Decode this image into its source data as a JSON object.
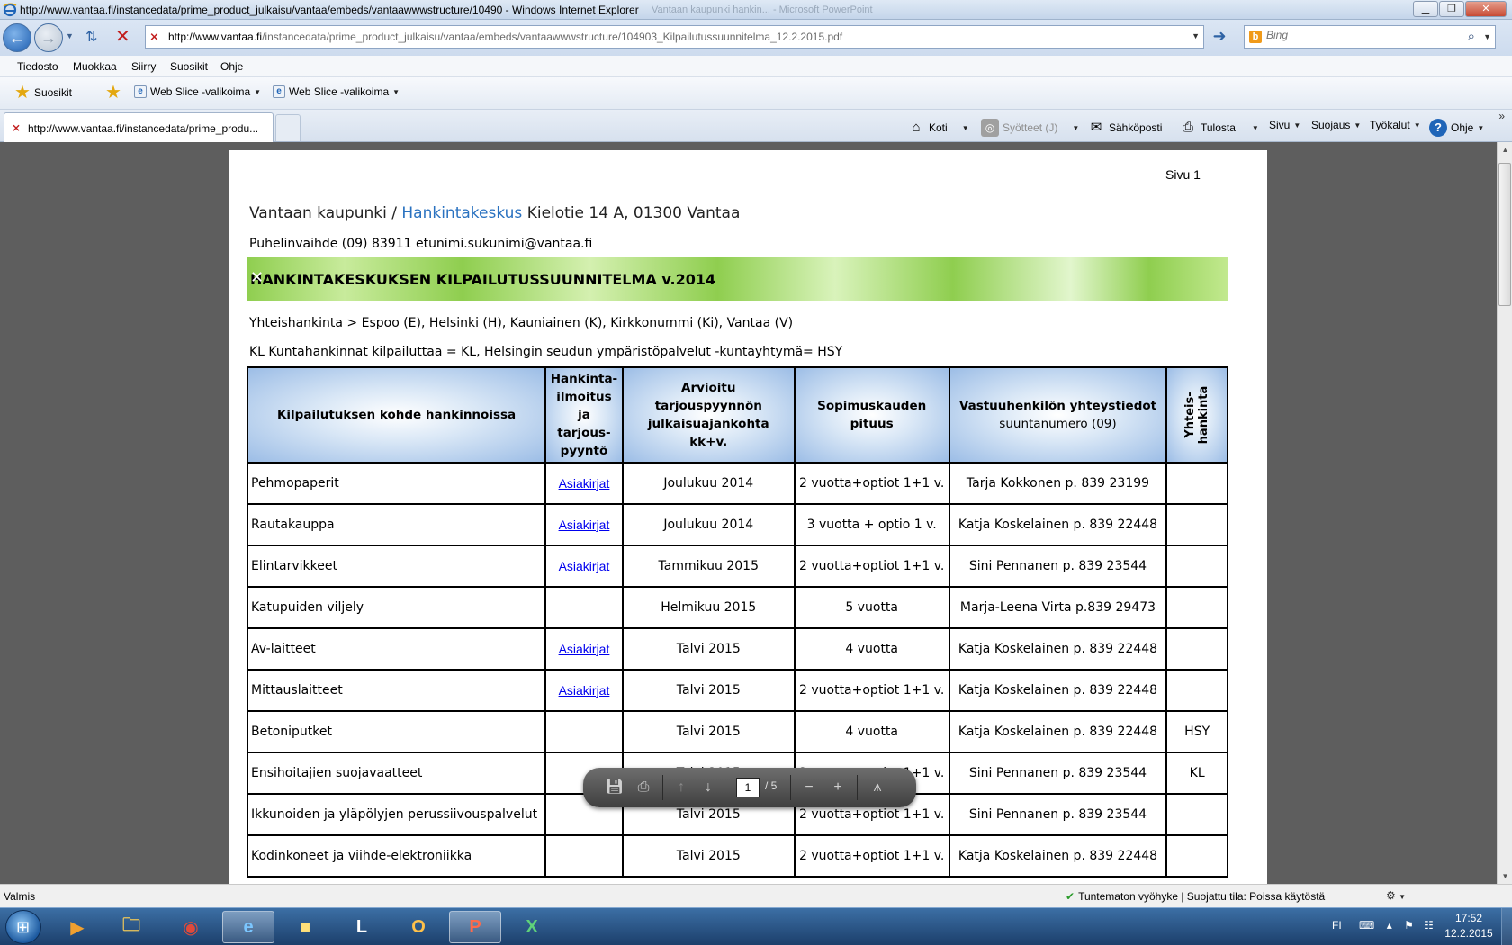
{
  "window": {
    "title": "http://www.vantaa.fi/instancedata/prime_product_julkaisu/vantaa/embeds/vantaawwwstructure/10490 - Windows Internet Explorer",
    "ghost_title": "Vantaan kaupunki hankin... - Microsoft PowerPoint"
  },
  "address_bar": {
    "url_domain": "http://www.vantaa.fi",
    "url_path": "/instancedata/prime_product_julkaisu/vantaa/embeds/vantaawwwstructure/104903_Kilpailutussuunnitelma_12.2.2015.pdf"
  },
  "search": {
    "placeholder": "Bing"
  },
  "menu": [
    "Tiedosto",
    "Muokkaa",
    "Siirry",
    "Suosikit",
    "Ohje"
  ],
  "favorites": {
    "label": "Suosikit",
    "slice1": "Web Slice -valikoima",
    "slice2": "Web Slice -valikoima"
  },
  "tab": {
    "title": "http://www.vantaa.fi/instancedata/prime_produ..."
  },
  "commands": {
    "home": "Koti",
    "feeds": "Syötteet (J)",
    "email": "Sähköposti",
    "print": "Tulosta",
    "page": "Sivu",
    "safety": "Suojaus",
    "tools": "Työkalut",
    "help": "Ohje"
  },
  "document": {
    "page_label": "Sivu 1",
    "org": "Vantaan kaupunki / ",
    "org_link": "Hankintakeskus",
    "org_address": " Kielotie 14 A, 01300 Vantaa",
    "phone": "Puhelinvaihde (09)  83911   etunimi.sukunimi@vantaa.fi",
    "banner": "HANKINTAKESKUKSEN KILPAILUTUSSUUNNITELMA v.2014",
    "joint_line": "Yhteishankinta >  Espoo (E), Helsinki (H), Kauniainen (K), Kirkkonummi (Ki), Vantaa (V)",
    "kl_line": "KL Kuntahankinnat kilpailuttaa = KL, Helsingin seudun ympäristöpalvelut -kuntayhtymä= HSY",
    "headers": {
      "subject": "Kilpailutuksen kohde hankinnoissa",
      "notice_l1": "Hankinta-",
      "notice_l2": "ilmoitus ja",
      "notice_l3": "tarjous-",
      "notice_l4": "pyyntö",
      "date_l1": "Arvioitu tarjouspyynnön",
      "date_l2": "julkaisuajankohta kk+v.",
      "duration": "Sopimuskauden pituus",
      "contact_l1": "Vastuuhenkilön yhteystiedot",
      "contact_l2": "suuntanumero (09)",
      "joint_l1": "Yhteis-",
      "joint_l2": "hankinta"
    },
    "rows": [
      {
        "subject": "Pehmopaperit",
        "doc": "Asiakirjat",
        "date": "Joulukuu 2014",
        "duration": "2 vuotta+optiot 1+1 v.",
        "contact": "Tarja Kokkonen p. 839 23199",
        "joint": ""
      },
      {
        "subject": "Rautakauppa",
        "doc": "Asiakirjat",
        "date": "Joulukuu 2014",
        "duration": "3 vuotta + optio 1 v.",
        "contact": "Katja Koskelainen p. 839 22448",
        "joint": ""
      },
      {
        "subject": "Elintarvikkeet",
        "doc": "Asiakirjat",
        "date": "Tammikuu 2015",
        "duration": "2 vuotta+optiot 1+1 v.",
        "contact": "Sini Pennanen p. 839 23544",
        "joint": ""
      },
      {
        "subject": "Katupuiden viljely",
        "doc": "",
        "date": "Helmikuu 2015",
        "duration": "5 vuotta",
        "contact": "Marja-Leena Virta p.839 29473",
        "joint": ""
      },
      {
        "subject": "Av-laitteet",
        "doc": "Asiakirjat",
        "date": "Talvi 2015",
        "duration": "4 vuotta",
        "contact": "Katja Koskelainen p. 839 22448",
        "joint": ""
      },
      {
        "subject": "Mittauslaitteet",
        "doc": "Asiakirjat",
        "date": "Talvi 2015",
        "duration": "2 vuotta+optiot 1+1 v.",
        "contact": "Katja Koskelainen p. 839 22448",
        "joint": ""
      },
      {
        "subject": "Betoniputket",
        "doc": "",
        "date": "Talvi 2015",
        "duration": "4 vuotta",
        "contact": "Katja Koskelainen p. 839 22448",
        "joint": "HSY"
      },
      {
        "subject": "Ensihoitajien suojavaatteet",
        "doc": "",
        "date": "Talvi 2015",
        "duration": "2 vuotta+optiot 1+1 v.",
        "contact": "Sini Pennanen p. 839 23544",
        "joint": "KL"
      },
      {
        "subject": "Ikkunoiden ja yläpölyjen perussiivouspalvelut",
        "doc": "",
        "date": "Talvi 2015",
        "duration": "2 vuotta+optiot 1+1 v.",
        "contact": "Sini Pennanen p. 839 23544",
        "joint": ""
      },
      {
        "subject": "Kodinkoneet ja viihde-elektroniikka",
        "doc": "",
        "date": "Talvi 2015",
        "duration": "2 vuotta+optiot 1+1 v.",
        "contact": "Katja Koskelainen p. 839 22448",
        "joint": ""
      }
    ]
  },
  "pdf_toolbar": {
    "page": "1",
    "total": "/ 5"
  },
  "status": {
    "text": "Valmis",
    "zone": "Tuntematon vyöhyke | Suojattu tila: Poissa käytöstä"
  },
  "taskbar": {
    "lang": "FI",
    "time": "17:52",
    "date": "12.2.2015"
  }
}
